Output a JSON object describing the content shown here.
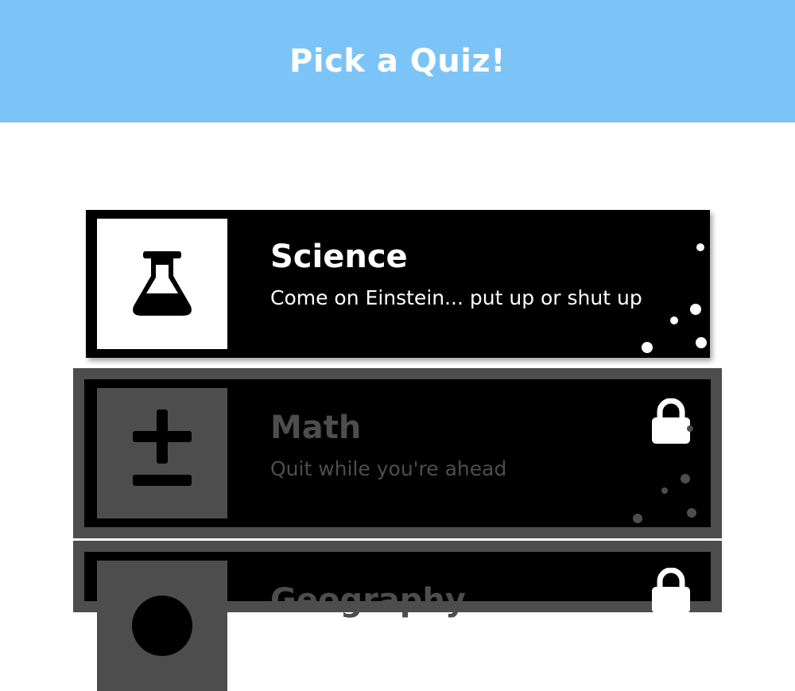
{
  "header": {
    "title": "Pick a Quiz!",
    "background": "#7cc4f8"
  },
  "quizzes": [
    {
      "title": "Science",
      "subtitle": "Come on Einstein... put up or shut up",
      "icon": "flask-icon",
      "locked": false
    },
    {
      "title": "Math",
      "subtitle": "Quit while you're ahead",
      "icon": "plus-minus-icon",
      "locked": true
    },
    {
      "title": "Geography",
      "subtitle": "",
      "icon": "globe-icon",
      "locked": true
    }
  ],
  "colors": {
    "card": "#000000",
    "locked_frame": "#4d4d4d",
    "text": "#ffffff"
  }
}
